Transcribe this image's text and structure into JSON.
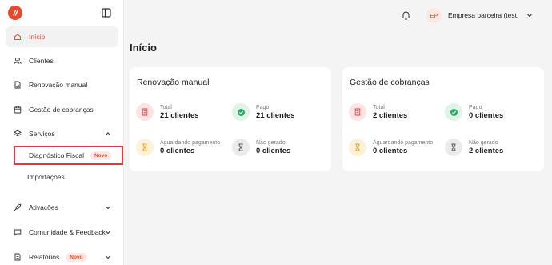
{
  "sidebar": {
    "items": [
      {
        "label": "Início",
        "icon": "home-icon"
      },
      {
        "label": "Clientes",
        "icon": "users-icon"
      },
      {
        "label": "Renovação manual",
        "icon": "document-refresh-icon"
      },
      {
        "label": "Gestão de cobranças",
        "icon": "calendar-icon"
      },
      {
        "label": "Serviços",
        "icon": "layers-icon"
      },
      {
        "label": "Ativações",
        "icon": "rocket-icon"
      },
      {
        "label": "Comunidade & Feedback",
        "icon": "chat-icon"
      },
      {
        "label": "Relatórios",
        "icon": "report-icon",
        "badge": "Novo"
      }
    ],
    "sub_items": [
      {
        "label": "Diagnóstico Fiscal",
        "badge": "Novo"
      },
      {
        "label": "Importações"
      }
    ]
  },
  "header": {
    "avatar_initials": "EP",
    "company_name": "Empresa parceira (test..."
  },
  "page": {
    "title": "Início"
  },
  "cards": [
    {
      "title": "Renovação manual",
      "stats": [
        {
          "label": "Total",
          "value": "21 clientes"
        },
        {
          "label": "Pago",
          "value": "21 clientes"
        },
        {
          "label": "Aguardando pagamento",
          "value": "0 clientes"
        },
        {
          "label": "Não gerado",
          "value": "0 clientes"
        }
      ]
    },
    {
      "title": "Gestão de cobranças",
      "stats": [
        {
          "label": "Total",
          "value": "2 clientes"
        },
        {
          "label": "Pago",
          "value": "0 clientes"
        },
        {
          "label": "Aguardando pagamento",
          "value": "0 clientes"
        },
        {
          "label": "Não gerado",
          "value": "2 clientes"
        }
      ]
    }
  ],
  "colors": {
    "accent": "#e64a2e",
    "highlight_border": "#e13a3a",
    "total_bg": "#fde4e4",
    "pago_bg": "#dff3e6",
    "aguardando_bg": "#fdf1d8",
    "nao_gerado_bg": "#ebebeb"
  }
}
